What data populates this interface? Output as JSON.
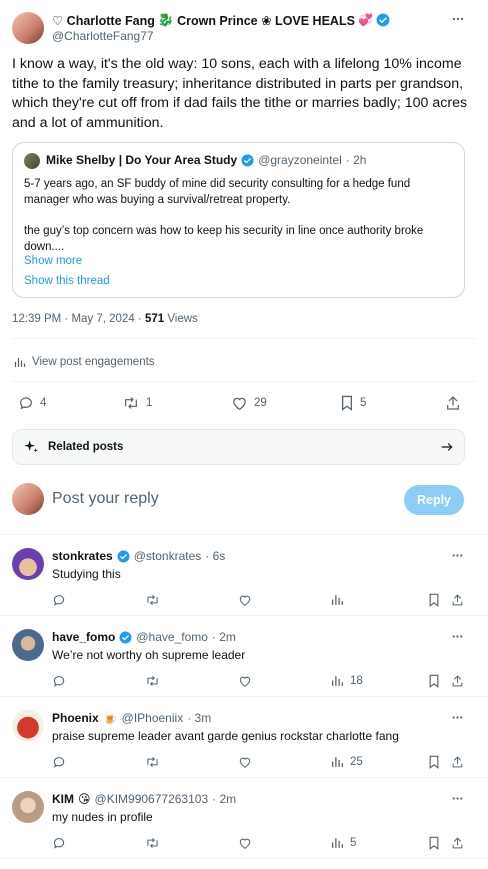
{
  "post": {
    "author_name": "♡ Charlotte Fang",
    "author_name_tail": "Crown Prince ❀ LOVE HEALS",
    "handle": "@CharlotteFang77",
    "text": "I know a way, it's the old way: 10 sons, each with a lifelong 10% income tithe to the family treasury; inheritance distributed in parts per grandson, which they're cut off from if dad fails the tithe or marries badly; 100 acres and a lot of ammunition.",
    "timestamp": "12:39 PM · May 7, 2024 · ",
    "views_count": "571",
    "views_label": " Views",
    "engagements_label": "View post engagements",
    "replies": "4",
    "reposts": "1",
    "likes": "29",
    "bookmarks": "5"
  },
  "quote": {
    "author_name": "Mike Shelby | Do Your Area Study",
    "handle": "@grayzoneintel",
    "time": "· 2h",
    "text1": "5-7 years ago, an SF buddy of mine did security consulting for a hedge fund manager who was buying a survival/retreat property.",
    "text2": "the guy’s top concern was how to keep his security in line once authority broke down....",
    "show_more": "Show more",
    "show_thread": "Show this thread"
  },
  "related": {
    "label": "Related posts"
  },
  "composer": {
    "placeholder": "Post your reply",
    "reply_label": "Reply"
  },
  "replies": [
    {
      "name": "stonkrates",
      "handle": "@stonkrates",
      "time": "· 6s",
      "text": "Studying this",
      "views": "",
      "verified": true,
      "emoji": ""
    },
    {
      "name": "have_fomo",
      "handle": "@have_fomo",
      "time": "· 2m",
      "text": "We’re not worthy oh supreme leader",
      "views": "18",
      "verified": true,
      "emoji": ""
    },
    {
      "name": "Phoenix",
      "handle": "@IPhoeniix",
      "time": "· 3m",
      "text": "praise supreme leader avant garde genius rockstar charlotte fang",
      "views": "25",
      "verified": false,
      "emoji": "🍺"
    },
    {
      "name": "KIM",
      "handle": "@KIM990677263103",
      "time": "· 2m",
      "text": "my nudes in profile",
      "views": "5",
      "verified": false,
      "emoji": "😘"
    }
  ],
  "colors": {
    "accent": "#1d9bf0",
    "muted": "#536471",
    "reply_button": "#8ecdf7",
    "divider": "#eff3f4"
  }
}
